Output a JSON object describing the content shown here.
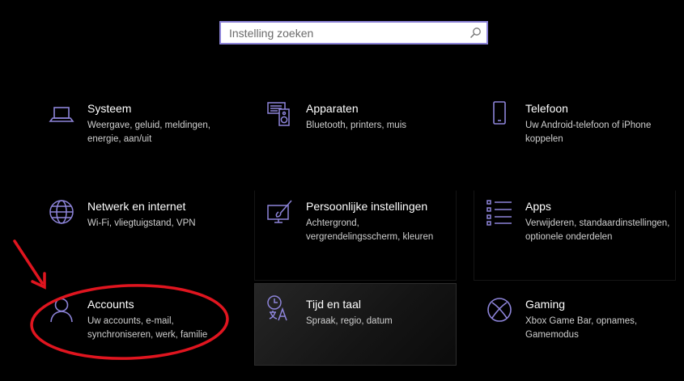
{
  "search": {
    "placeholder": "Instelling zoeken",
    "icon": "search-icon"
  },
  "accent_color": "#8d84d9",
  "tiles": [
    {
      "title": "Systeem",
      "desc": "Weergave, geluid, meldingen, energie, aan/uit",
      "icon": "laptop-icon"
    },
    {
      "title": "Apparaten",
      "desc": "Bluetooth, printers, muis",
      "icon": "devices-icon"
    },
    {
      "title": "Telefoon",
      "desc": "Uw Android-telefoon of iPhone koppelen",
      "icon": "phone-icon"
    },
    {
      "title": "Netwerk en internet",
      "desc": "Wi-Fi, vliegtuigstand, VPN",
      "icon": "globe-icon"
    },
    {
      "title": "Persoonlijke instellingen",
      "desc": "Achtergrond, vergrendelingsscherm, kleuren",
      "icon": "personalization-icon"
    },
    {
      "title": "Apps",
      "desc": "Verwijderen, standaardinstellingen, optionele onderdelen",
      "icon": "apps-list-icon"
    },
    {
      "title": "Accounts",
      "desc": "Uw accounts, e-mail, synchroniseren, werk, familie",
      "icon": "person-icon"
    },
    {
      "title": "Tijd en taal",
      "desc": "Spraak, regio, datum",
      "icon": "time-language-icon"
    },
    {
      "title": "Gaming",
      "desc": "Xbox Game Bar, opnames, Gamemodus",
      "icon": "xbox-icon"
    }
  ],
  "annotation": {
    "color": "#e0151f"
  }
}
